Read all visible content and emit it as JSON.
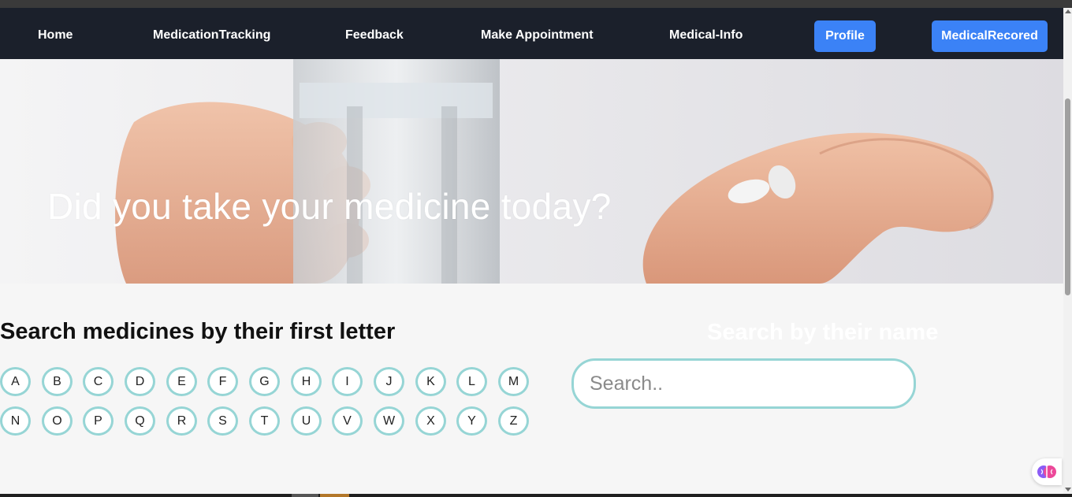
{
  "nav": {
    "links": [
      "Home",
      "MedicationTracking",
      "Feedback",
      "Make Appointment",
      "Medical-Info"
    ],
    "profile_button": "Profile",
    "medical_record_button": "MedicalRecored"
  },
  "hero": {
    "title": "Did you take your medicine today?"
  },
  "letters_section": {
    "heading": "Search medicines by their first letter",
    "row1": [
      "A",
      "B",
      "C",
      "D",
      "E",
      "F",
      "G",
      "H",
      "I",
      "J",
      "K",
      "L",
      "M"
    ],
    "row2": [
      "N",
      "O",
      "P",
      "Q",
      "R",
      "S",
      "T",
      "U",
      "V",
      "W",
      "X",
      "Y",
      "Z"
    ]
  },
  "name_search": {
    "heading": "Search by their name",
    "placeholder": "Search..",
    "value": ""
  },
  "colors": {
    "navbar": "#1b202b",
    "button_blue": "#3b82f6",
    "letter_border": "#96d5d5"
  },
  "icons": {
    "extension": "brain-icon"
  }
}
